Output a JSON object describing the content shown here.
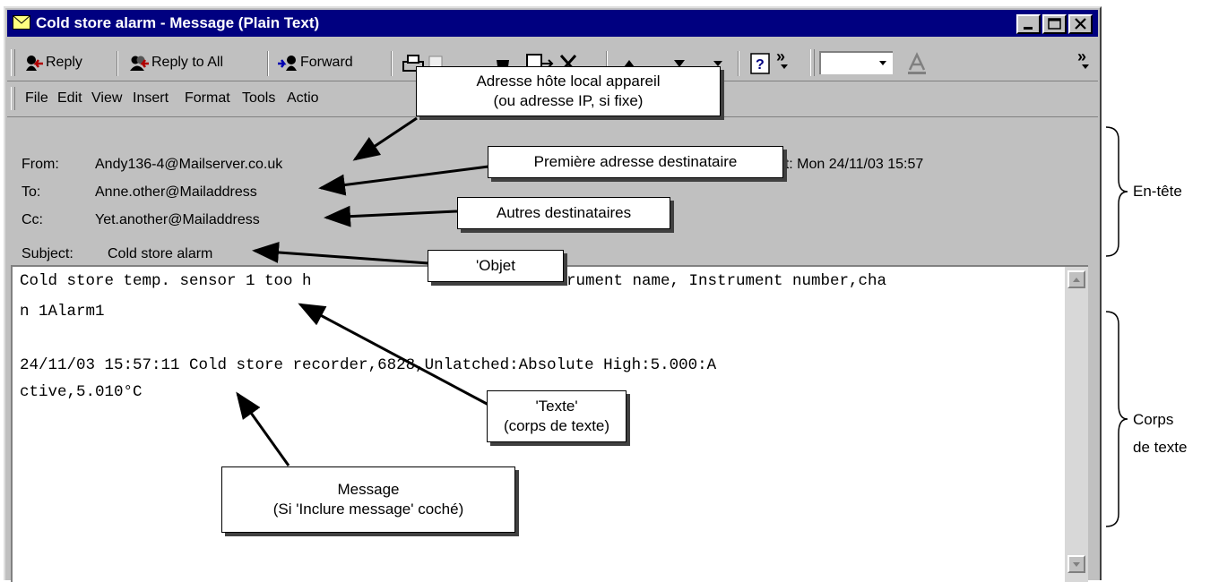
{
  "window": {
    "title": "Cold store alarm - Message (Plain Text)",
    "controls": {
      "minimize": "_",
      "maximize": "□",
      "close": "×"
    }
  },
  "toolbar": {
    "reply": "Reply",
    "reply_all": "Reply to All",
    "forward": "Forward",
    "overflow": "»"
  },
  "menu": {
    "file": "File",
    "edit": "Edit",
    "view": "View",
    "insert": "Insert",
    "format": "Format",
    "tools": "Tools",
    "actions": "Actio"
  },
  "header": {
    "from_label": "From:",
    "from_value": "Andy136-4@Mailserver.co.uk",
    "to_label": "To:",
    "to_value": "Anne.other@Mailaddress",
    "cc_label": "Cc:",
    "cc_value": "Yet.another@Mailaddress",
    "subject_label": "Subject:",
    "subject_value": "Cold store alarm",
    "sent_partial": "ent:  Mon 24/11/03 15:57"
  },
  "body": {
    "line1": "Cold store temp. sensor 1 too h",
    "line1_tail": "rument name, Instrument number,cha",
    "line2": "n 1Alarm1",
    "line3": "24/11/03 15:57:11 Cold store recorder,6828,Unlatched:Absolute High:5.000:A",
    "line4": "ctive,5.010°C"
  },
  "callouts": {
    "host": [
      "Adresse hôte local appareil",
      "(ou adresse IP, si fixe)"
    ],
    "first_recipient": "Première adresse destinataire",
    "other_recipients": "Autres destinataires",
    "object": "'Objet",
    "text": [
      "'Texte'",
      "(corps de texte)"
    ],
    "message": [
      "Message",
      "(Si 'Inclure message' coché)"
    ]
  },
  "side_labels": {
    "header": "En-tête",
    "body": [
      "Corps",
      "de texte"
    ]
  },
  "colors": {
    "titlebar": "#000080",
    "chrome": "#c0c0c0"
  }
}
